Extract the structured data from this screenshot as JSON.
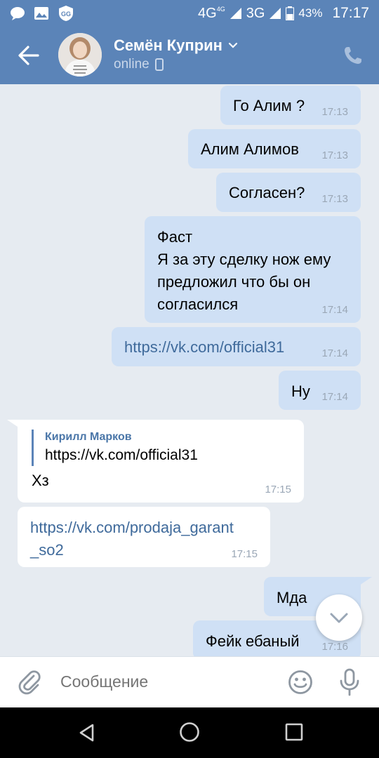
{
  "status_bar": {
    "network1": "4G",
    "network1_sup": "4G",
    "network2": "3G",
    "battery": "43%",
    "time": "17:17"
  },
  "header": {
    "contact_name": "Семён Куприн",
    "status": "online"
  },
  "messages": [
    {
      "dir": "out",
      "text": "Го Алим ?",
      "time": "17:13"
    },
    {
      "dir": "out",
      "text": "Алим Алимов",
      "time": "17:13"
    },
    {
      "dir": "out",
      "text": "Согласен?",
      "time": "17:13"
    },
    {
      "dir": "out",
      "text": "Фаст\nЯ за эту сделку нож ему\nпредложил что бы он\nсогласился",
      "time": "17:14"
    },
    {
      "dir": "out",
      "text": "https://vk.com/official31",
      "time": "17:14"
    },
    {
      "dir": "out",
      "text": "Ну",
      "time": "17:14"
    },
    {
      "dir": "in",
      "quote_author": "Кирилл Марков",
      "quote_text": "https://vk.com/official31",
      "text": "Хз",
      "time": "17:15"
    },
    {
      "dir": "in",
      "text": "https://vk.com/prodaja_garant\n_so2",
      "time": "17:15"
    },
    {
      "dir": "out",
      "text": "Мда",
      "time": ""
    },
    {
      "dir": "out",
      "text": "Фейк ебаный",
      "time": "17:16"
    }
  ],
  "input": {
    "placeholder": "Сообщение"
  },
  "colors": {
    "header": "#5b84b8",
    "outgoing_bubble": "#cfe0f5",
    "incoming_bubble": "#ffffff",
    "chat_background": "#e6ebf1",
    "link": "#3f6a9b"
  }
}
